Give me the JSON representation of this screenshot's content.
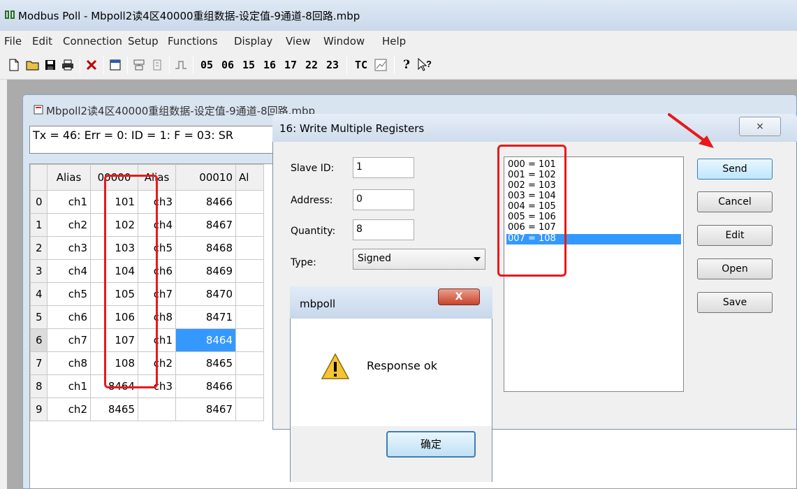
{
  "app": {
    "title": "Modbus Poll - Mbpoll2读4区40000重组数据-设定值-9通道-8回路.mbp",
    "menu": [
      "File",
      "Edit",
      "Connection",
      "Setup",
      "Functions",
      "Display",
      "View",
      "Window",
      "Help"
    ],
    "toolbar_codes": [
      "05",
      "06",
      "15",
      "16",
      "17",
      "22",
      "23",
      "TC"
    ]
  },
  "child": {
    "title": "Mbpoll2读4区40000重组数据-设定值-9通道-8回路.mbp",
    "status": "Tx = 46: Err = 0: ID = 1: F = 03: SR",
    "headers": [
      "Alias",
      "00000",
      "Alias",
      "00010",
      "Al"
    ],
    "rows": [
      {
        "n": "0",
        "a1": "ch1",
        "v1": "101",
        "a2": "ch3",
        "v2": "8466"
      },
      {
        "n": "1",
        "a1": "ch2",
        "v1": "102",
        "a2": "ch4",
        "v2": "8467"
      },
      {
        "n": "2",
        "a1": "ch3",
        "v1": "103",
        "a2": "ch5",
        "v2": "8468"
      },
      {
        "n": "3",
        "a1": "ch4",
        "v1": "104",
        "a2": "ch6",
        "v2": "8469"
      },
      {
        "n": "4",
        "a1": "ch5",
        "v1": "105",
        "a2": "ch7",
        "v2": "8470"
      },
      {
        "n": "5",
        "a1": "ch6",
        "v1": "106",
        "a2": "ch8",
        "v2": "8471"
      },
      {
        "n": "6",
        "a1": "ch7",
        "v1": "107",
        "a2": "ch1",
        "v2": "8464"
      },
      {
        "n": "7",
        "a1": "ch8",
        "v1": "108",
        "a2": "ch2",
        "v2": "8465"
      },
      {
        "n": "8",
        "a1": "ch1",
        "v1": "8464",
        "a2": "ch3",
        "v2": "8466"
      },
      {
        "n": "9",
        "a1": "ch2",
        "v1": "8465",
        "a2": "",
        "v2": "8467"
      }
    ]
  },
  "dialog": {
    "title": "16: Write Multiple Registers",
    "close": "⨯",
    "slave_id_label": "Slave ID:",
    "slave_id": "1",
    "address_label": "Address:",
    "address": "0",
    "quantity_label": "Quantity:",
    "quantity": "8",
    "type_label": "Type:",
    "type": "Signed",
    "registers": [
      "000 = 101",
      "001 = 102",
      "002 = 103",
      "003 = 104",
      "004 = 105",
      "005 = 106",
      "006 = 107",
      "007 = 108"
    ],
    "buttons": {
      "send": "Send",
      "cancel": "Cancel",
      "edit": "Edit",
      "open": "Open",
      "save": "Save"
    }
  },
  "msgbox": {
    "title": "mbpoll",
    "message": "Response ok",
    "ok": "确定",
    "close": "X"
  },
  "colors": {
    "annotation": "#e8191a",
    "selection": "#3399ff"
  }
}
